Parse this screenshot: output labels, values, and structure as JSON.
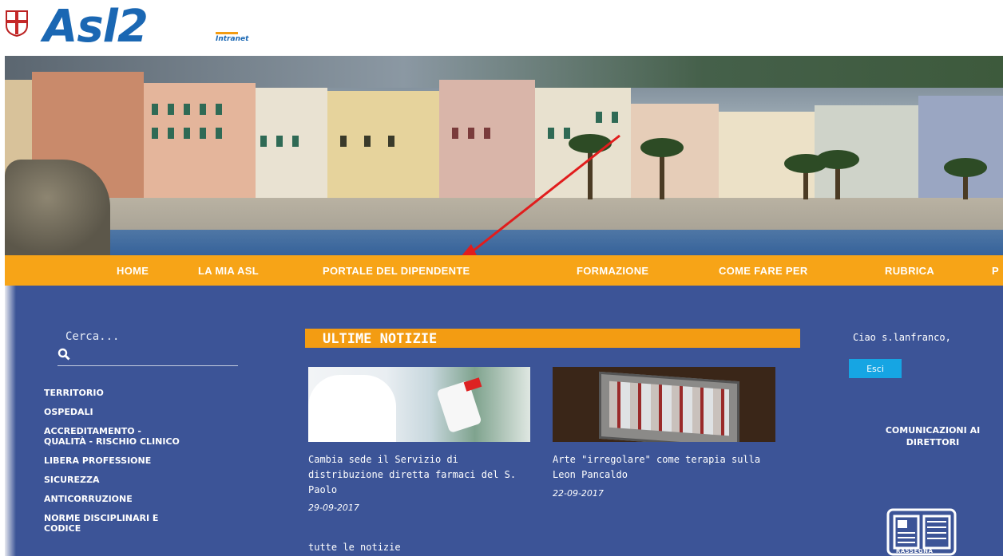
{
  "header": {
    "logo_main": "Asl2",
    "logo_sub": "Intranet"
  },
  "nav": {
    "items": [
      {
        "label": "HOME"
      },
      {
        "label": "LA MIA ASL"
      },
      {
        "label": "PORTALE DEL DIPENDENTE"
      },
      {
        "label": "FORMAZIONE"
      },
      {
        "label": "COME FARE PER"
      },
      {
        "label": "RUBRICA"
      },
      {
        "label": "P"
      }
    ]
  },
  "sidebar": {
    "search_placeholder": "Cerca...",
    "items": [
      {
        "label": "TERRITORIO"
      },
      {
        "label": "OSPEDALI"
      },
      {
        "label": "ACCREDITAMENTO - QUALITÀ - RISCHIO CLINICO"
      },
      {
        "label": "LIBERA PROFESSIONE"
      },
      {
        "label": "SICUREZZA"
      },
      {
        "label": "ANTICORRUZIONE"
      },
      {
        "label": "NORME DISCIPLINARI E CODICE"
      }
    ]
  },
  "news": {
    "heading": "ULTIME NOTIZIE",
    "articles": [
      {
        "title": "Cambia sede il Servizio di distribuzione diretta farmaci del S. Paolo",
        "date": "29-09-2017"
      },
      {
        "title": "Arte \"irregolare\" come terapia sulla Leon Pancaldo",
        "date": "22-09-2017"
      }
    ],
    "all_link": "tutte le notizie"
  },
  "user": {
    "greeting": "Ciao s.lanfranco,",
    "logout_label": "Esci"
  },
  "right": {
    "communications_label": "COMUNICAZIONI AI DIRETTORI",
    "rassegna_label": "RASSEGNA"
  },
  "colors": {
    "nav_bg": "#f7a417",
    "content_bg": "#3c5497",
    "logo_blue": "#1a67b3",
    "logout_bg": "#16a5e3"
  }
}
